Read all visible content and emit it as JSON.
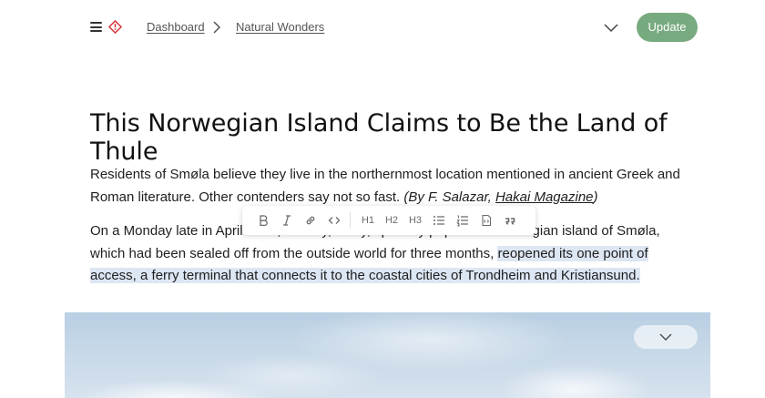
{
  "header": {
    "breadcrumb": [
      "Dashboard",
      "Natural Wonders"
    ],
    "update_label": "Update",
    "icons": [
      "hamburger-menu-icon",
      "alert-diamond-icon",
      "chevron-right-icon",
      "chevron-down-icon"
    ]
  },
  "article": {
    "title": "This Norwegian Island Claims to Be the Land of Thule",
    "p1_text": "Residents of Smøla believe they live in the northernmost location  mentioned in ancient Greek and Roman literature. Other contenders say not so fast. ",
    "p1_credit_prefix": "(By F. Salazar, ",
    "p1_credit_link": "Hakai Magazine",
    "p1_credit_suffix": ")",
    "p2_start": "On a Monday late in April 20",
    "p2_hidden": "20, the tiny, rocky, sparsely populated Norwegian i",
    "p2_mid": "sland of Smøla, which had been sealed off from the outside  world for three months, ",
    "p2_highlight": "reopened its one point of access, a ferry  terminal that connects it to the coastal cities of Trondheim and  Kristiansund."
  },
  "toolbar": {
    "h1": "H1",
    "h2": "H2",
    "h3": "H3",
    "icons": [
      "bold-icon",
      "italic-icon",
      "link-icon",
      "code-icon",
      "bullet-list-icon",
      "numbered-list-icon",
      "embed-icon",
      "quote-icon"
    ]
  },
  "colors": {
    "accent": "#78aa80",
    "highlight": "#dde6f3",
    "alert": "#d9363e"
  }
}
